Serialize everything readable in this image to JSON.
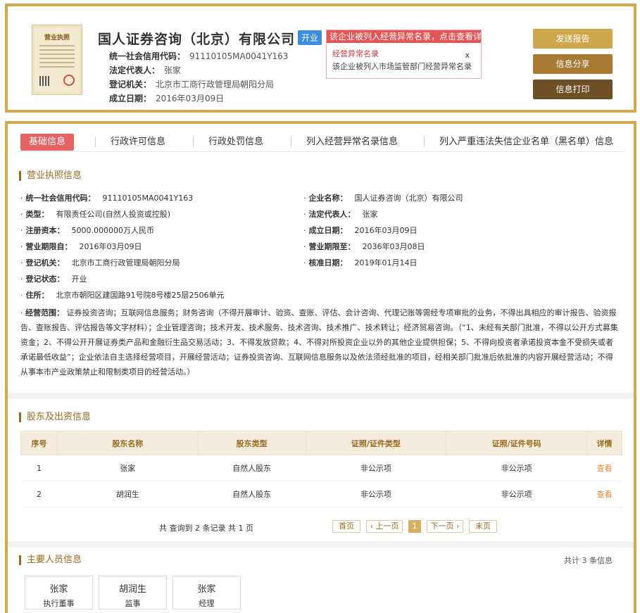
{
  "header": {
    "license_title": "营业执照",
    "company_name": "国人证券咨询（北京）有限公司",
    "status": "开业",
    "credit_code_label": "统一社会信用代码：",
    "credit_code": "91110105MA0041Y163",
    "legal_rep_label": "法定代表人：",
    "legal_rep": "张家",
    "reg_authority_label": "登记机关：",
    "reg_authority": "北京市工商行政管理局朝阳分局",
    "found_date_label": "成立日期：",
    "found_date": "2016年03月09日",
    "abnormal": {
      "head": "该企业被列入经营异常名录，点击查看详情",
      "title": "经营异常名录",
      "close": "x",
      "desc": "该企业被列入市场监管部门经营异常名录"
    },
    "buttons": {
      "report": "发送报告",
      "share": "信息分享",
      "print": "信息打印"
    }
  },
  "tabs": [
    "基础信息",
    "行政许可信息",
    "行政处罚信息",
    "列入经营异常名录信息",
    "列入严重违法失信企业名单（黑名单）信息"
  ],
  "license_section": {
    "title": "营业执照信息",
    "bullet": "·",
    "left": [
      {
        "label": "统一社会信用代码：",
        "value": "91110105MA0041Y163"
      },
      {
        "label": "类型：",
        "value": "有限责任公司(自然人投资或控股)"
      },
      {
        "label": "注册资本：",
        "value": "5000.000000万人民币"
      },
      {
        "label": "营业期限自：",
        "value": "2016年03月09日"
      },
      {
        "label": "登记机关：",
        "value": "北京市工商行政管理局朝阳分局"
      },
      {
        "label": "登记状态：",
        "value": "开业"
      },
      {
        "label": "住所：",
        "value": "北京市朝阳区建国路91号院8号楼25层2506单元"
      }
    ],
    "right": [
      {
        "label": "企业名称：",
        "value": "国人证券咨询（北京）有限公司"
      },
      {
        "label": "法定代表人：",
        "value": "张家"
      },
      {
        "label": "成立日期：",
        "value": "2016年03月09日"
      },
      {
        "label": "营业期限至：",
        "value": "2036年03月08日"
      },
      {
        "label": "核准日期：",
        "value": "2019年01月14日"
      }
    ],
    "scope_label": "经营范围：",
    "scope": "证券投资咨询；互联网信息服务；财务咨询（不得开展审计、验资、查账、评估、会计咨询、代理记账等需经专项审批的业务，不得出具相应的审计报告、验资报告、查账报告、评估报告等文字材料）；企业管理咨询；技术开发、技术服务、技术咨询、技术推广、技术转让；经济贸易咨询。（“1、未经有关部门批准，不得以公开方式募集资金；2、不得公开开展证券类产品和金融衍生品交易活动；3、不得发放贷款；4、不得对所投资企业以外的其他企业提供担保；5、不得向投资者承诺投资本金不受损失或者承诺最低收益”；企业依法自主选择经营项目，开展经营活动；证券投资咨询、互联网信息服务以及依法须经批准的项目，经相关部门批准后依批准的内容开展经营活动；不得从事本市产业政策禁止和限制类项目的经营活动。）"
  },
  "shareholders": {
    "title": "股东及出资信息",
    "columns": [
      "序号",
      "股东名称",
      "股东类型",
      "证照/证件类型",
      "证照/证件号码",
      "详情"
    ],
    "rows": [
      [
        "1",
        "张家",
        "自然人股东",
        "非公示项",
        "非公示项",
        "查看"
      ],
      [
        "2",
        "胡润生",
        "自然人股东",
        "非公示项",
        "非公示项",
        "查看"
      ]
    ],
    "pager_info": "共 查询到 2 条记录 共 1 页",
    "pager": {
      "first": "首页",
      "prev": "‹ 上一页",
      "current": "1",
      "next": "下一页 ›",
      "last": "末页"
    }
  },
  "people": {
    "title": "主要人员信息",
    "count": "共计 3 条信息",
    "list": [
      {
        "name": "张家",
        "role": "执行董事"
      },
      {
        "name": "胡润生",
        "role": "监事"
      },
      {
        "name": "张家",
        "role": "经理"
      }
    ]
  }
}
